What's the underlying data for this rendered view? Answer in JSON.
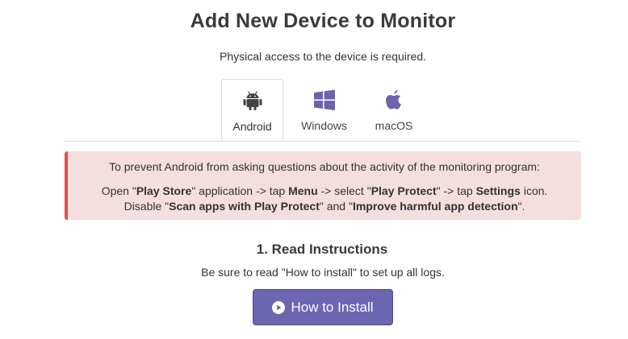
{
  "header": {
    "title": "Add New Device to Monitor",
    "subtitle": "Physical access to the device is required."
  },
  "tabs": [
    {
      "label": "Android",
      "icon": "android-icon",
      "active": true
    },
    {
      "label": "Windows",
      "icon": "windows-icon",
      "active": false
    },
    {
      "label": "macOS",
      "icon": "apple-icon",
      "active": false
    }
  ],
  "alert": {
    "line1": "To prevent Android from asking questions about the activity of the monitoring program:",
    "line2": {
      "t1": "Open \"",
      "b1": "Play Store",
      "t2": "\" application -> tap ",
      "b2": "Menu",
      "t3": " -> select \"",
      "b3": "Play Protect",
      "t4": "\" -> tap ",
      "b4": "Settings",
      "t5": " icon."
    },
    "line3": {
      "t1": "Disable \"",
      "b1": "Scan apps with Play Protect",
      "t2": "\" and \"",
      "b2": "Improve harmful app detection",
      "t3": "\"."
    }
  },
  "step": {
    "title": "1. Read Instructions",
    "description": "Be sure to read \"How to install\" to set up all logs.",
    "button_label": "How to Install",
    "button_icon": "play-circle-icon"
  },
  "colors": {
    "alert_bg": "#f4dede",
    "alert_border": "#d9534f",
    "button_bg": "#6c66b0",
    "icon_dark": "#444444",
    "icon_purple": "#6a64ad"
  }
}
